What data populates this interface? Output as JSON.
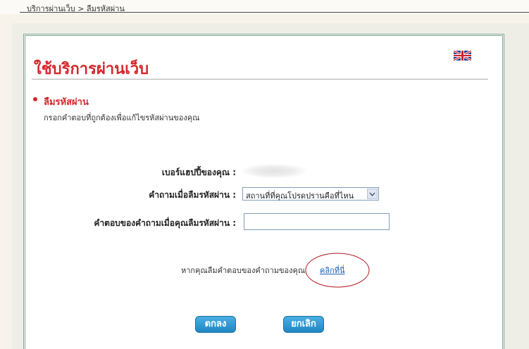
{
  "breadcrumb": "บริการผ่านเว็บ > ลืมรหัสผ่าน",
  "page_title": "ใช้บริการผ่านเว็บ",
  "language_flag_icon": "uk-flag-icon",
  "section": {
    "title": "ลืมรหัสผ่าน",
    "instruction": "กรอกคำตอบที่ถูกต้องเพื่อแก้ไขรหัสผ่านของคุณ"
  },
  "form": {
    "number_label": "เบอร์แฮปปี้ของคุณ :",
    "question_label": "คำถามเมื่อลืมรหัสผ่าน :",
    "question_value": "สถานที่ที่คุณโปรดปรานคือที่ไหน",
    "answer_label": "คำตอบของคำถามเมื่อคุณลืมรหัสผ่าน :",
    "answer_value": ""
  },
  "hint": {
    "text": "หากคุณลืมคำตอบของคำถามของคุณ",
    "link": "คลิกที่นี่"
  },
  "buttons": {
    "ok": "ตกลง",
    "cancel": "ยกเลิก"
  },
  "colors": {
    "accent_red": "#d5262b",
    "button_blue": "#2b94d0",
    "annotation_red": "#b0101a"
  }
}
